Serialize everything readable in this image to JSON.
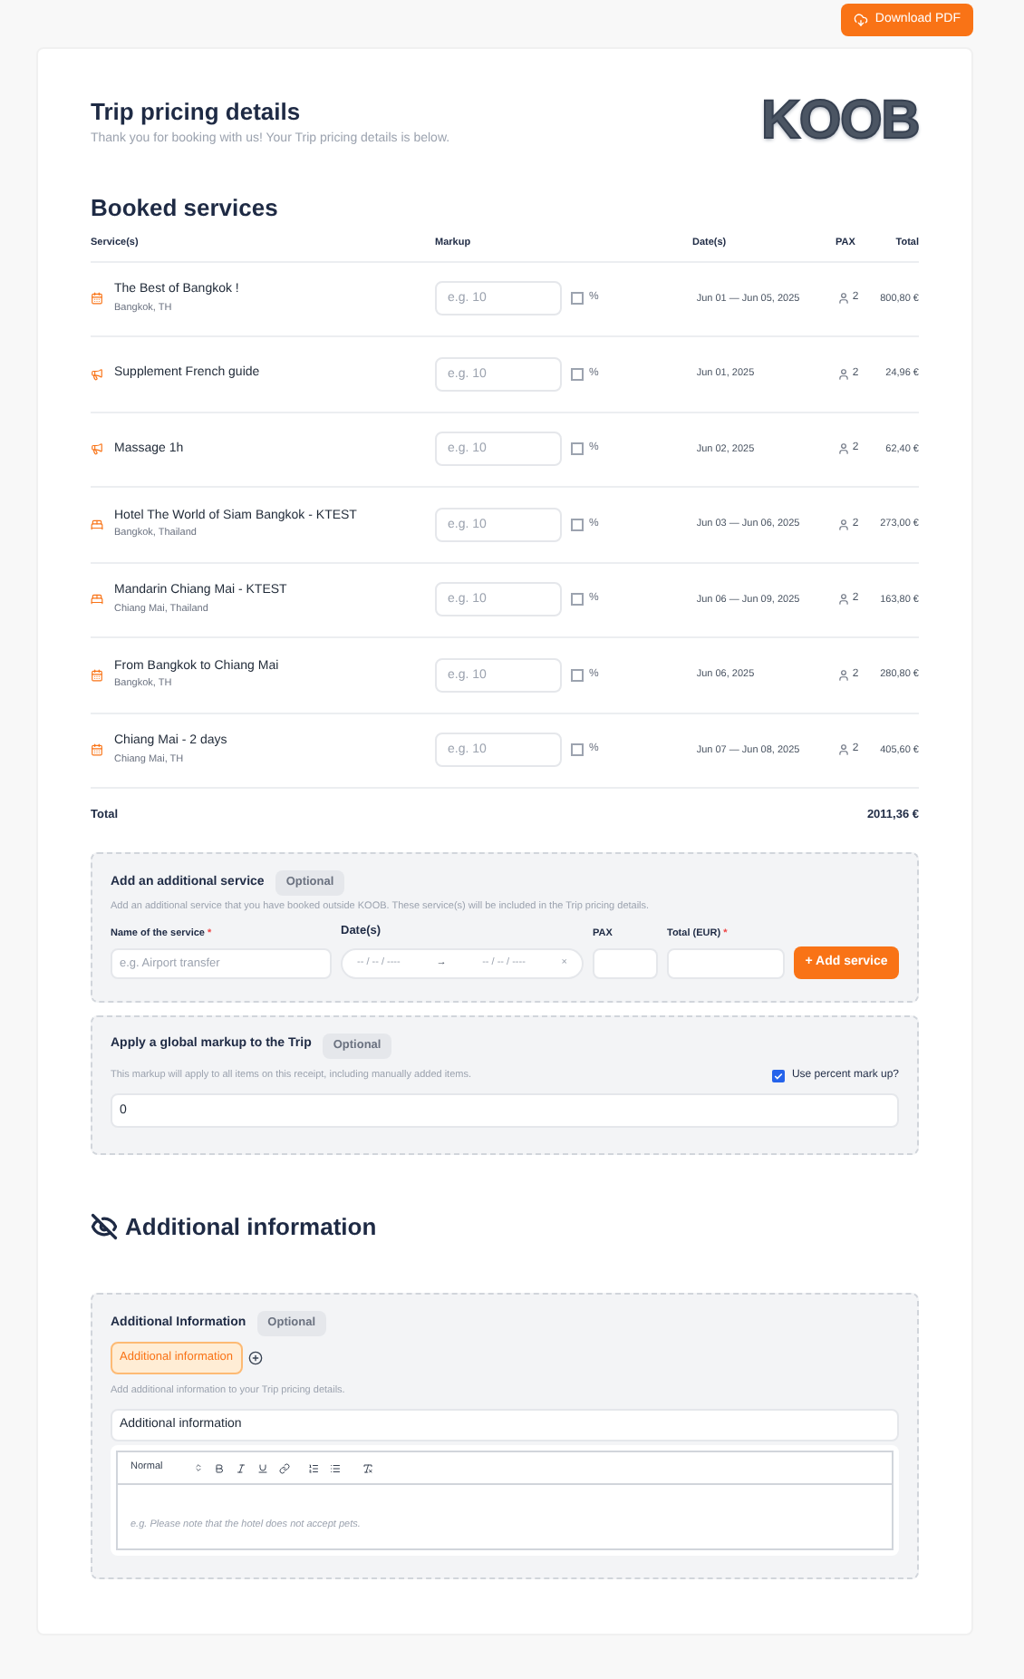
{
  "download_button": "Download PDF",
  "header": {
    "title": "Trip pricing details",
    "subtitle": "Thank you for booking with us! Your Trip pricing details is below.",
    "logo": "KOOB"
  },
  "booked_services": {
    "title": "Booked services",
    "columns": [
      "Service(s)",
      "Markup",
      "Date(s)",
      "PAX",
      "Total"
    ],
    "rows": [
      {
        "kind": "activity",
        "name": "The Best of Bangkok !",
        "location": "Bangkok, TH",
        "markup_placeholder": "e.g. 10",
        "percent": false,
        "percent_label": "%",
        "dates": "Jun 01 — Jun 05, 2025",
        "pax": "2",
        "total": "800,80 €"
      },
      {
        "kind": "extra",
        "name": "Supplement French guide",
        "markup_placeholder": "e.g. 10",
        "percent": false,
        "percent_label": "%",
        "dates": "Jun 01, 2025",
        "pax": "2",
        "total": "24,96 €"
      },
      {
        "kind": "extra",
        "name": "Massage 1h",
        "markup_placeholder": "e.g. 10",
        "percent": false,
        "percent_label": "%",
        "dates": "Jun 02, 2025",
        "pax": "2",
        "total": "62,40 €"
      },
      {
        "kind": "hotel",
        "name": "Hotel The World of Siam Bangkok - KTEST",
        "location": "Bangkok, Thailand",
        "markup_placeholder": "e.g. 10",
        "percent": false,
        "percent_label": "%",
        "dates": "Jun 03 — Jun 06, 2025",
        "pax": "2",
        "total": "273,00 €"
      },
      {
        "kind": "hotel",
        "name": "Mandarin Chiang Mai - KTEST",
        "location": "Chiang Mai, Thailand",
        "markup_placeholder": "e.g. 10",
        "percent": false,
        "percent_label": "%",
        "dates": "Jun 06 — Jun 09, 2025",
        "pax": "2",
        "total": "163,80 €"
      },
      {
        "kind": "activity",
        "name": "From Bangkok to Chiang Mai",
        "location": "Bangkok, TH",
        "markup_placeholder": "e.g. 10",
        "percent": false,
        "percent_label": "%",
        "dates": "Jun 06, 2025",
        "pax": "2",
        "total": "280,80 €"
      },
      {
        "kind": "activity",
        "name": "Chiang Mai - 2 days",
        "location": "Chiang Mai, TH",
        "markup_placeholder": "e.g. 10",
        "percent": false,
        "percent_label": "%",
        "dates": "Jun 07 — Jun 08, 2025",
        "pax": "2",
        "total": "405,60 €"
      }
    ],
    "total_label": "Total",
    "total": "2011,36 €"
  },
  "additional_service": {
    "title": "Add an additional service",
    "badge": "Optional",
    "description": "Add an additional service that you have booked outside KOOB. These service(s) will be included in the Trip pricing details.",
    "name_label": "Name of the service",
    "required_mark": "*",
    "name_placeholder": "e.g. Airport transfer",
    "dates_label": "Date(s)",
    "start_placeholder": "-- / -- / ----",
    "arrow": "→",
    "end_placeholder": "-- / -- / ----",
    "clear": "×",
    "pax_label": "PAX",
    "total_label": "Total (EUR)",
    "total_required_mark": "*",
    "add_button": "+ Add service"
  },
  "global_markup": {
    "title": "Apply a global markup to the Trip",
    "badge": "Optional",
    "description": "This markup will apply to all items on this receipt, including manually added items.",
    "percent_label": "Use percent mark up?",
    "percent_checked": true,
    "value": "0"
  },
  "additional_information": {
    "heading": "Additional information",
    "title": "Additional Information",
    "badge": "Optional",
    "tab": "Additional information",
    "tab_selected": true,
    "description": "Add additional information to your Trip pricing details.",
    "field_value": "Additional information",
    "format": "Normal",
    "editor_placeholder": "e.g. Please note that the hotel does not accept pets."
  }
}
